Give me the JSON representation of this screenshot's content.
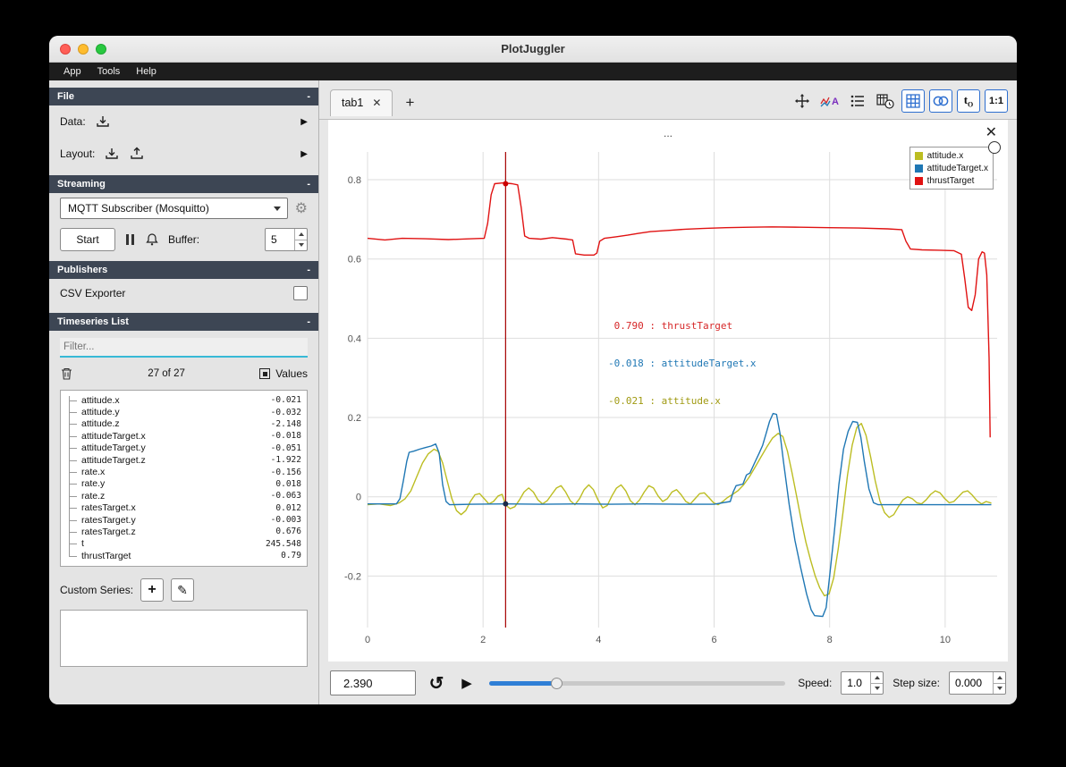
{
  "window": {
    "title": "PlotJuggler",
    "menu": [
      "App",
      "Tools",
      "Help"
    ]
  },
  "icons": {
    "expand": "▶",
    "gear": "⚙",
    "loop": "↺",
    "play": "▶",
    "plus": "+",
    "pencil": "✎",
    "tab_close": "✕",
    "plot_close": "✕"
  },
  "sidebar": {
    "file": {
      "header": "File",
      "collapse": "-",
      "data_label": "Data:",
      "layout_label": "Layout:"
    },
    "streaming": {
      "header": "Streaming",
      "collapse": "-",
      "source": "MQTT Subscriber (Mosquitto)",
      "start": "Start",
      "buffer_label": "Buffer:",
      "buffer_value": "5"
    },
    "publishers": {
      "header": "Publishers",
      "collapse": "-",
      "csv_label": "CSV Exporter"
    },
    "timeseries": {
      "header": "Timeseries List",
      "collapse": "-",
      "filter_placeholder": "Filter...",
      "count": "27 of 27",
      "values_label": "Values",
      "items": [
        {
          "name": "attitude.x",
          "value": "-0.021"
        },
        {
          "name": "attitude.y",
          "value": "-0.032"
        },
        {
          "name": "attitude.z",
          "value": "-2.148"
        },
        {
          "name": "attitudeTarget.x",
          "value": "-0.018"
        },
        {
          "name": "attitudeTarget.y",
          "value": "-0.051"
        },
        {
          "name": "attitudeTarget.z",
          "value": "-1.922"
        },
        {
          "name": "rate.x",
          "value": "-0.156"
        },
        {
          "name": "rate.y",
          "value": "0.018"
        },
        {
          "name": "rate.z",
          "value": "-0.063"
        },
        {
          "name": "ratesTarget.x",
          "value": "0.012"
        },
        {
          "name": "ratesTarget.y",
          "value": "-0.003"
        },
        {
          "name": "ratesTarget.z",
          "value": "0.676"
        },
        {
          "name": "t",
          "value": "245.548"
        },
        {
          "name": "thrustTarget",
          "value": "0.79"
        }
      ]
    },
    "custom_series": {
      "label": "Custom Series:"
    }
  },
  "main": {
    "tab_label": "tab1",
    "toolbar": {
      "t_label": "t",
      "t_sub": "O",
      "ratio": "1:1"
    },
    "plot_title": "...",
    "legend": [
      {
        "label": "attitude.x",
        "color": "#bcbd22"
      },
      {
        "label": "attitudeTarget.x",
        "color": "#1f77b4"
      },
      {
        "label": "thrustTarget",
        "color": "#e01212"
      }
    ],
    "tracker_lines": [
      {
        "value": "0.790",
        "sep": " : ",
        "label": "thrustTarget",
        "color": "#d62728"
      },
      {
        "value": "-0.018",
        "sep": " : ",
        "label": "attitudeTarget.x",
        "color": "#1f77b4"
      },
      {
        "value": "-0.021",
        "sep": " : ",
        "label": "attitude.x",
        "color": "#a09a12"
      }
    ]
  },
  "bottom": {
    "time": "2.390",
    "speed_label": "Speed:",
    "speed_value": "1.0",
    "step_label": "Step size:",
    "step_value": "0.000",
    "slider_pos": 0.23
  },
  "chart_data": {
    "type": "line",
    "title": "...",
    "xlabel": "",
    "ylabel": "",
    "xlim": [
      0,
      10.9
    ],
    "ylim": [
      -0.33,
      0.87
    ],
    "x_ticks": [
      0,
      2,
      4,
      6,
      8,
      10
    ],
    "y_ticks": [
      -0.2,
      0,
      0.2,
      0.4,
      0.6,
      0.8
    ],
    "grid": true,
    "legend_position": "top-right",
    "tracker": {
      "x": 2.39,
      "color": "#a50000",
      "dots": [
        {
          "y": 0.79,
          "color": "#cc0000"
        },
        {
          "y": -0.018,
          "color": "#1b2a4a"
        }
      ]
    },
    "series": [
      {
        "name": "attitude.x",
        "color": "#bcbd22",
        "points": [
          [
            0,
            -0.02
          ],
          [
            0.2,
            -0.018
          ],
          [
            0.4,
            -0.022
          ],
          [
            0.55,
            -0.015
          ],
          [
            0.65,
            -0.005
          ],
          [
            0.75,
            0.015
          ],
          [
            0.85,
            0.05
          ],
          [
            0.95,
            0.085
          ],
          [
            1.05,
            0.108
          ],
          [
            1.15,
            0.12
          ],
          [
            1.22,
            0.115
          ],
          [
            1.3,
            0.085
          ],
          [
            1.38,
            0.04
          ],
          [
            1.46,
            -0.005
          ],
          [
            1.54,
            -0.035
          ],
          [
            1.62,
            -0.045
          ],
          [
            1.7,
            -0.035
          ],
          [
            1.78,
            -0.012
          ],
          [
            1.86,
            0.005
          ],
          [
            1.94,
            0.008
          ],
          [
            2.02,
            -0.005
          ],
          [
            2.1,
            -0.018
          ],
          [
            2.18,
            -0.012
          ],
          [
            2.26,
            0.002
          ],
          [
            2.33,
            0.006
          ],
          [
            2.39,
            -0.021
          ],
          [
            2.47,
            -0.03
          ],
          [
            2.55,
            -0.025
          ],
          [
            2.63,
            -0.008
          ],
          [
            2.71,
            0.012
          ],
          [
            2.79,
            0.022
          ],
          [
            2.87,
            0.012
          ],
          [
            2.95,
            -0.008
          ],
          [
            3.03,
            -0.018
          ],
          [
            3.11,
            -0.01
          ],
          [
            3.19,
            0.006
          ],
          [
            3.27,
            0.022
          ],
          [
            3.35,
            0.028
          ],
          [
            3.43,
            0.012
          ],
          [
            3.51,
            -0.01
          ],
          [
            3.59,
            -0.02
          ],
          [
            3.67,
            -0.005
          ],
          [
            3.75,
            0.018
          ],
          [
            3.83,
            0.03
          ],
          [
            3.91,
            0.018
          ],
          [
            3.99,
            -0.008
          ],
          [
            4.07,
            -0.028
          ],
          [
            4.15,
            -0.022
          ],
          [
            4.23,
            0.002
          ],
          [
            4.31,
            0.022
          ],
          [
            4.39,
            0.03
          ],
          [
            4.47,
            0.015
          ],
          [
            4.55,
            -0.01
          ],
          [
            4.63,
            -0.02
          ],
          [
            4.71,
            -0.008
          ],
          [
            4.79,
            0.012
          ],
          [
            4.87,
            0.028
          ],
          [
            4.95,
            0.022
          ],
          [
            5.03,
            0.002
          ],
          [
            5.11,
            -0.012
          ],
          [
            5.19,
            -0.005
          ],
          [
            5.27,
            0.012
          ],
          [
            5.35,
            0.018
          ],
          [
            5.43,
            0.005
          ],
          [
            5.51,
            -0.012
          ],
          [
            5.59,
            -0.018
          ],
          [
            5.67,
            -0.005
          ],
          [
            5.75,
            0.008
          ],
          [
            5.83,
            0.01
          ],
          [
            5.91,
            -0.002
          ],
          [
            5.99,
            -0.015
          ],
          [
            6.07,
            -0.02
          ],
          [
            6.15,
            -0.012
          ],
          [
            6.23,
            -0.002
          ],
          [
            6.31,
            0.005
          ],
          [
            6.41,
            0.015
          ],
          [
            6.51,
            0.03
          ],
          [
            6.61,
            0.05
          ],
          [
            6.71,
            0.075
          ],
          [
            6.81,
            0.1
          ],
          [
            6.91,
            0.125
          ],
          [
            7.01,
            0.148
          ],
          [
            7.11,
            0.16
          ],
          [
            7.19,
            0.152
          ],
          [
            7.27,
            0.115
          ],
          [
            7.35,
            0.06
          ],
          [
            7.43,
            0
          ],
          [
            7.51,
            -0.06
          ],
          [
            7.59,
            -0.115
          ],
          [
            7.67,
            -0.16
          ],
          [
            7.75,
            -0.2
          ],
          [
            7.83,
            -0.23
          ],
          [
            7.91,
            -0.25
          ],
          [
            7.99,
            -0.245
          ],
          [
            8.07,
            -0.205
          ],
          [
            8.15,
            -0.13
          ],
          [
            8.23,
            -0.04
          ],
          [
            8.31,
            0.055
          ],
          [
            8.39,
            0.13
          ],
          [
            8.47,
            0.175
          ],
          [
            8.55,
            0.185
          ],
          [
            8.63,
            0.155
          ],
          [
            8.71,
            0.1
          ],
          [
            8.79,
            0.04
          ],
          [
            8.87,
            -0.01
          ],
          [
            8.95,
            -0.04
          ],
          [
            9.03,
            -0.052
          ],
          [
            9.11,
            -0.045
          ],
          [
            9.19,
            -0.025
          ],
          [
            9.27,
            -0.008
          ],
          [
            9.35,
            0
          ],
          [
            9.43,
            -0.005
          ],
          [
            9.51,
            -0.015
          ],
          [
            9.59,
            -0.018
          ],
          [
            9.67,
            -0.008
          ],
          [
            9.75,
            0.006
          ],
          [
            9.83,
            0.015
          ],
          [
            9.91,
            0.01
          ],
          [
            9.99,
            -0.004
          ],
          [
            10.07,
            -0.015
          ],
          [
            10.15,
            -0.012
          ],
          [
            10.23,
            0
          ],
          [
            10.31,
            0.012
          ],
          [
            10.39,
            0.015
          ],
          [
            10.47,
            0.004
          ],
          [
            10.55,
            -0.01
          ],
          [
            10.63,
            -0.018
          ],
          [
            10.71,
            -0.012
          ],
          [
            10.8,
            -0.016
          ]
        ]
      },
      {
        "name": "attitudeTarget.x",
        "color": "#1f77b4",
        "points": [
          [
            0,
            -0.018
          ],
          [
            0.5,
            -0.018
          ],
          [
            0.56,
            -0.005
          ],
          [
            0.62,
            0.04
          ],
          [
            0.68,
            0.09
          ],
          [
            0.72,
            0.112
          ],
          [
            0.8,
            0.115
          ],
          [
            0.9,
            0.12
          ],
          [
            1,
            0.124
          ],
          [
            1.1,
            0.128
          ],
          [
            1.18,
            0.133
          ],
          [
            1.24,
            0.11
          ],
          [
            1.3,
            0.03
          ],
          [
            1.36,
            -0.012
          ],
          [
            1.42,
            -0.02
          ],
          [
            1.8,
            -0.019
          ],
          [
            2.39,
            -0.018
          ],
          [
            3,
            -0.019
          ],
          [
            3.6,
            -0.018
          ],
          [
            4.2,
            -0.019
          ],
          [
            4.8,
            -0.018
          ],
          [
            5.4,
            -0.019
          ],
          [
            6,
            -0.019
          ],
          [
            6.28,
            -0.012
          ],
          [
            6.33,
            0.012
          ],
          [
            6.38,
            0.028
          ],
          [
            6.5,
            0.032
          ],
          [
            6.56,
            0.055
          ],
          [
            6.62,
            0.06
          ],
          [
            6.7,
            0.085
          ],
          [
            6.78,
            0.11
          ],
          [
            6.84,
            0.13
          ],
          [
            6.9,
            0.16
          ],
          [
            6.96,
            0.19
          ],
          [
            7.02,
            0.21
          ],
          [
            7.08,
            0.208
          ],
          [
            7.14,
            0.16
          ],
          [
            7.2,
            0.09
          ],
          [
            7.3,
            -0.02
          ],
          [
            7.4,
            -0.11
          ],
          [
            7.5,
            -0.18
          ],
          [
            7.6,
            -0.245
          ],
          [
            7.68,
            -0.285
          ],
          [
            7.74,
            -0.3
          ],
          [
            7.88,
            -0.302
          ],
          [
            7.94,
            -0.28
          ],
          [
            8,
            -0.2
          ],
          [
            8.08,
            -0.09
          ],
          [
            8.16,
            0.03
          ],
          [
            8.24,
            0.12
          ],
          [
            8.32,
            0.165
          ],
          [
            8.4,
            0.19
          ],
          [
            8.48,
            0.188
          ],
          [
            8.54,
            0.15
          ],
          [
            8.6,
            0.09
          ],
          [
            8.68,
            0.02
          ],
          [
            8.76,
            -0.015
          ],
          [
            8.84,
            -0.02
          ],
          [
            9.2,
            -0.02
          ],
          [
            9.8,
            -0.02
          ],
          [
            10.4,
            -0.02
          ],
          [
            10.8,
            -0.02
          ]
        ]
      },
      {
        "name": "thrustTarget",
        "color": "#e01212",
        "points": [
          [
            0,
            0.652
          ],
          [
            0.3,
            0.648
          ],
          [
            0.6,
            0.652
          ],
          [
            1,
            0.651
          ],
          [
            1.4,
            0.649
          ],
          [
            1.8,
            0.651
          ],
          [
            2.02,
            0.652
          ],
          [
            2.08,
            0.69
          ],
          [
            2.14,
            0.762
          ],
          [
            2.2,
            0.79
          ],
          [
            2.35,
            0.792
          ],
          [
            2.5,
            0.79
          ],
          [
            2.6,
            0.787
          ],
          [
            2.66,
            0.73
          ],
          [
            2.72,
            0.658
          ],
          [
            2.8,
            0.652
          ],
          [
            3,
            0.65
          ],
          [
            3.2,
            0.654
          ],
          [
            3.45,
            0.65
          ],
          [
            3.55,
            0.648
          ],
          [
            3.6,
            0.613
          ],
          [
            3.75,
            0.61
          ],
          [
            3.92,
            0.61
          ],
          [
            3.97,
            0.615
          ],
          [
            4.02,
            0.645
          ],
          [
            4.1,
            0.652
          ],
          [
            4.3,
            0.656
          ],
          [
            4.5,
            0.66
          ],
          [
            4.7,
            0.665
          ],
          [
            4.9,
            0.669
          ],
          [
            5.2,
            0.672
          ],
          [
            5.5,
            0.675
          ],
          [
            5.8,
            0.677
          ],
          [
            6.2,
            0.679
          ],
          [
            6.6,
            0.68
          ],
          [
            7,
            0.681
          ],
          [
            7.5,
            0.68
          ],
          [
            8,
            0.679
          ],
          [
            8.5,
            0.678
          ],
          [
            9,
            0.676
          ],
          [
            9.25,
            0.674
          ],
          [
            9.32,
            0.645
          ],
          [
            9.4,
            0.625
          ],
          [
            9.6,
            0.623
          ],
          [
            9.9,
            0.622
          ],
          [
            10.15,
            0.621
          ],
          [
            10.28,
            0.612
          ],
          [
            10.34,
            0.55
          ],
          [
            10.4,
            0.478
          ],
          [
            10.46,
            0.47
          ],
          [
            10.52,
            0.51
          ],
          [
            10.58,
            0.6
          ],
          [
            10.64,
            0.618
          ],
          [
            10.68,
            0.615
          ],
          [
            10.72,
            0.56
          ],
          [
            10.76,
            0.35
          ],
          [
            10.78,
            0.15
          ]
        ]
      }
    ]
  }
}
